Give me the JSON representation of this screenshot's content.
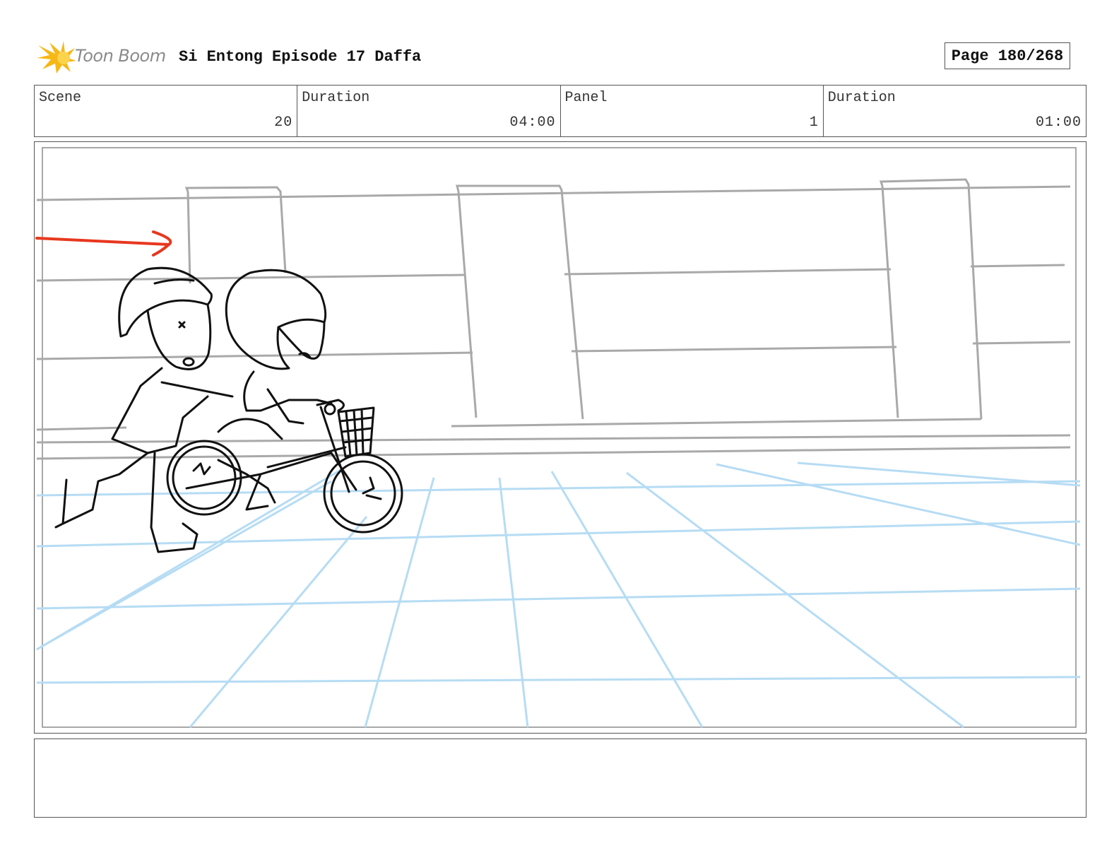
{
  "header": {
    "logo_text": "Toon Boom",
    "title": "Si Entong Episode 17 Daffa",
    "page": "Page 180/268"
  },
  "info": {
    "scene_label": "Scene",
    "scene_value": "20",
    "scene_duration_label": "Duration",
    "scene_duration_value": "04:00",
    "panel_label": "Panel",
    "panel_value": "1",
    "panel_duration_label": "Duration",
    "panel_duration_value": "01:00"
  },
  "notes": {
    "text": ""
  },
  "colors": {
    "arrow": "#e8371e",
    "guide_lines": "#b6dcf4",
    "wall_lines": "#a9a9a9",
    "logo_star": "#f6b817"
  }
}
